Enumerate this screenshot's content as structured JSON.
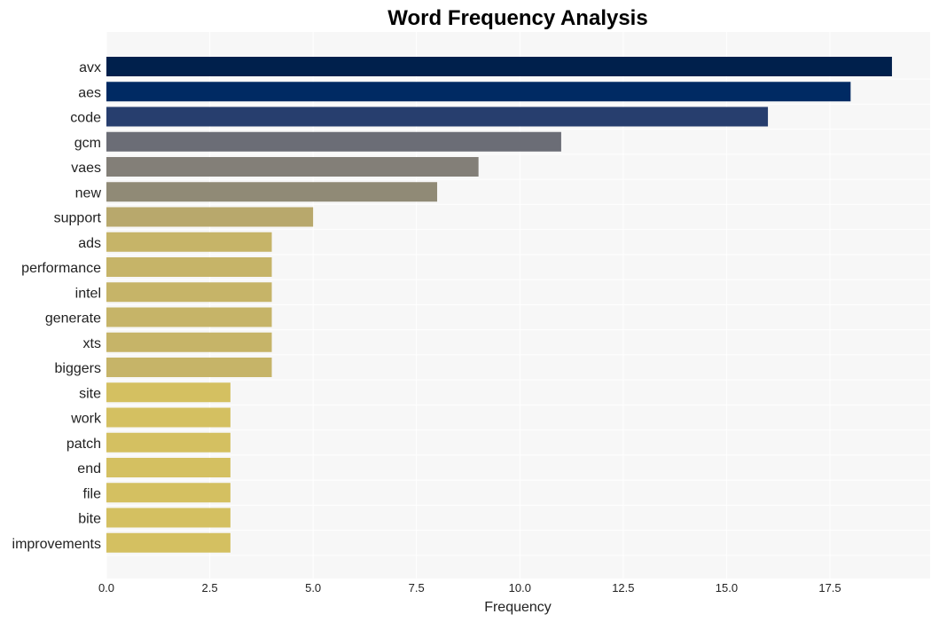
{
  "chart_data": {
    "type": "bar",
    "orientation": "horizontal",
    "title": "Word Frequency Analysis",
    "xlabel": "Frequency",
    "ylabel": "",
    "xlim": [
      0,
      19.95
    ],
    "xticks": [
      0,
      2.5,
      5,
      7.5,
      10,
      12.5,
      15,
      17.5
    ],
    "xtick_labels": [
      "0.0",
      "2.5",
      "5.0",
      "7.5",
      "10.0",
      "12.5",
      "15.0",
      "17.5"
    ],
    "grid": true,
    "categories": [
      "avx",
      "aes",
      "code",
      "gcm",
      "vaes",
      "new",
      "support",
      "ads",
      "performance",
      "intel",
      "generate",
      "xts",
      "biggers",
      "site",
      "work",
      "patch",
      "end",
      "file",
      "bite",
      "improvements"
    ],
    "values": [
      19,
      18,
      16,
      11,
      9,
      8,
      5,
      4,
      4,
      4,
      4,
      4,
      4,
      3,
      3,
      3,
      3,
      3,
      3,
      3
    ],
    "colors": [
      "#00204c",
      "#002a63",
      "#273e6e",
      "#6b6d76",
      "#837f78",
      "#908a76",
      "#b8a86c",
      "#c6b468",
      "#c6b468",
      "#c6b468",
      "#c6b468",
      "#c6b468",
      "#c6b468",
      "#d4c061",
      "#d4c061",
      "#d4c061",
      "#d4c061",
      "#d4c061",
      "#d4c061",
      "#d4c061"
    ],
    "background": "#f7f7f7"
  }
}
